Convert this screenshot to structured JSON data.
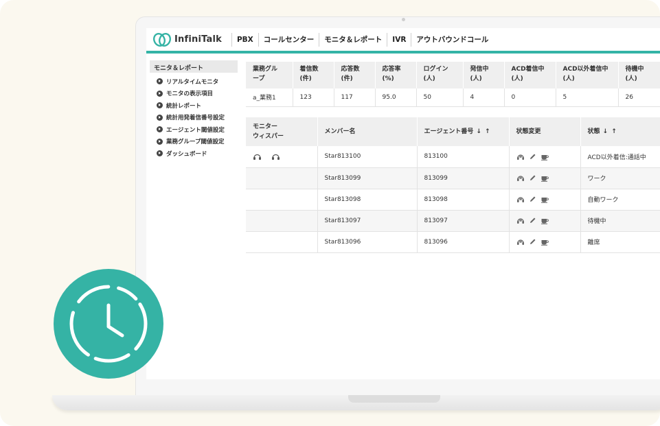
{
  "brand": {
    "name": "InfiniTalk",
    "accent_color": "#35b3a5"
  },
  "nav": {
    "items": [
      "PBX",
      "コールセンター",
      "モニタ＆レポート",
      "IVR",
      "アウトバウンドコール"
    ]
  },
  "sidebar": {
    "title": "モニタ＆レポート",
    "items": [
      "リアルタイムモニタ",
      "モニタの表示項目",
      "統計レポート",
      "統計用発着信番号設定",
      "エージェント閾値設定",
      "業務グループ閾値設定",
      "ダッシュボード"
    ]
  },
  "summary_table": {
    "headers": [
      {
        "line1": "業務グル",
        "line2": "ープ"
      },
      {
        "line1": "着信数",
        "line2": "(件)"
      },
      {
        "line1": "応答数",
        "line2": "(件)"
      },
      {
        "line1": "応答率",
        "line2": "(%)"
      },
      {
        "line1": "ログイン",
        "line2": "(人)"
      },
      {
        "line1": "発信中",
        "line2": "(人)"
      },
      {
        "line1": "ACD着信中",
        "line2": "(人)"
      },
      {
        "line1": "ACD以外着信中",
        "line2": "(人)"
      },
      {
        "line1": "待機中",
        "line2": "(人)"
      }
    ],
    "row": [
      "a_業務1",
      "123",
      "117",
      "95.0",
      "50",
      "4",
      "0",
      "5",
      "26"
    ]
  },
  "agent_table": {
    "headers": {
      "monitor_line1": "モニター",
      "monitor_line2": "ウィスパー",
      "member": "メンバー名",
      "agent_no": "エージェント番号",
      "agent_no_sort": "↓ ↑",
      "state_change": "状態変更",
      "state": "状態",
      "state_sort": "↓ ↑"
    },
    "rows": [
      {
        "member": "Star813100",
        "agent_no": "813100",
        "state": "ACD以外着信:通話中"
      },
      {
        "member": "Star813099",
        "agent_no": "813099",
        "state": "ワーク"
      },
      {
        "member": "Star813098",
        "agent_no": "813098",
        "state": "自動ワーク"
      },
      {
        "member": "Star813097",
        "agent_no": "813097",
        "state": "待機中"
      },
      {
        "member": "Star813096",
        "agent_no": "813096",
        "state": "離席"
      }
    ],
    "monitor_icons": [
      "monitor-headset-icon",
      "whisper-headset-icon"
    ],
    "action_icons": [
      "headset-icon",
      "pencil-icon",
      "coffee-icon"
    ]
  },
  "badge": {
    "icon": "clock-icon",
    "color": "#35b3a5"
  }
}
